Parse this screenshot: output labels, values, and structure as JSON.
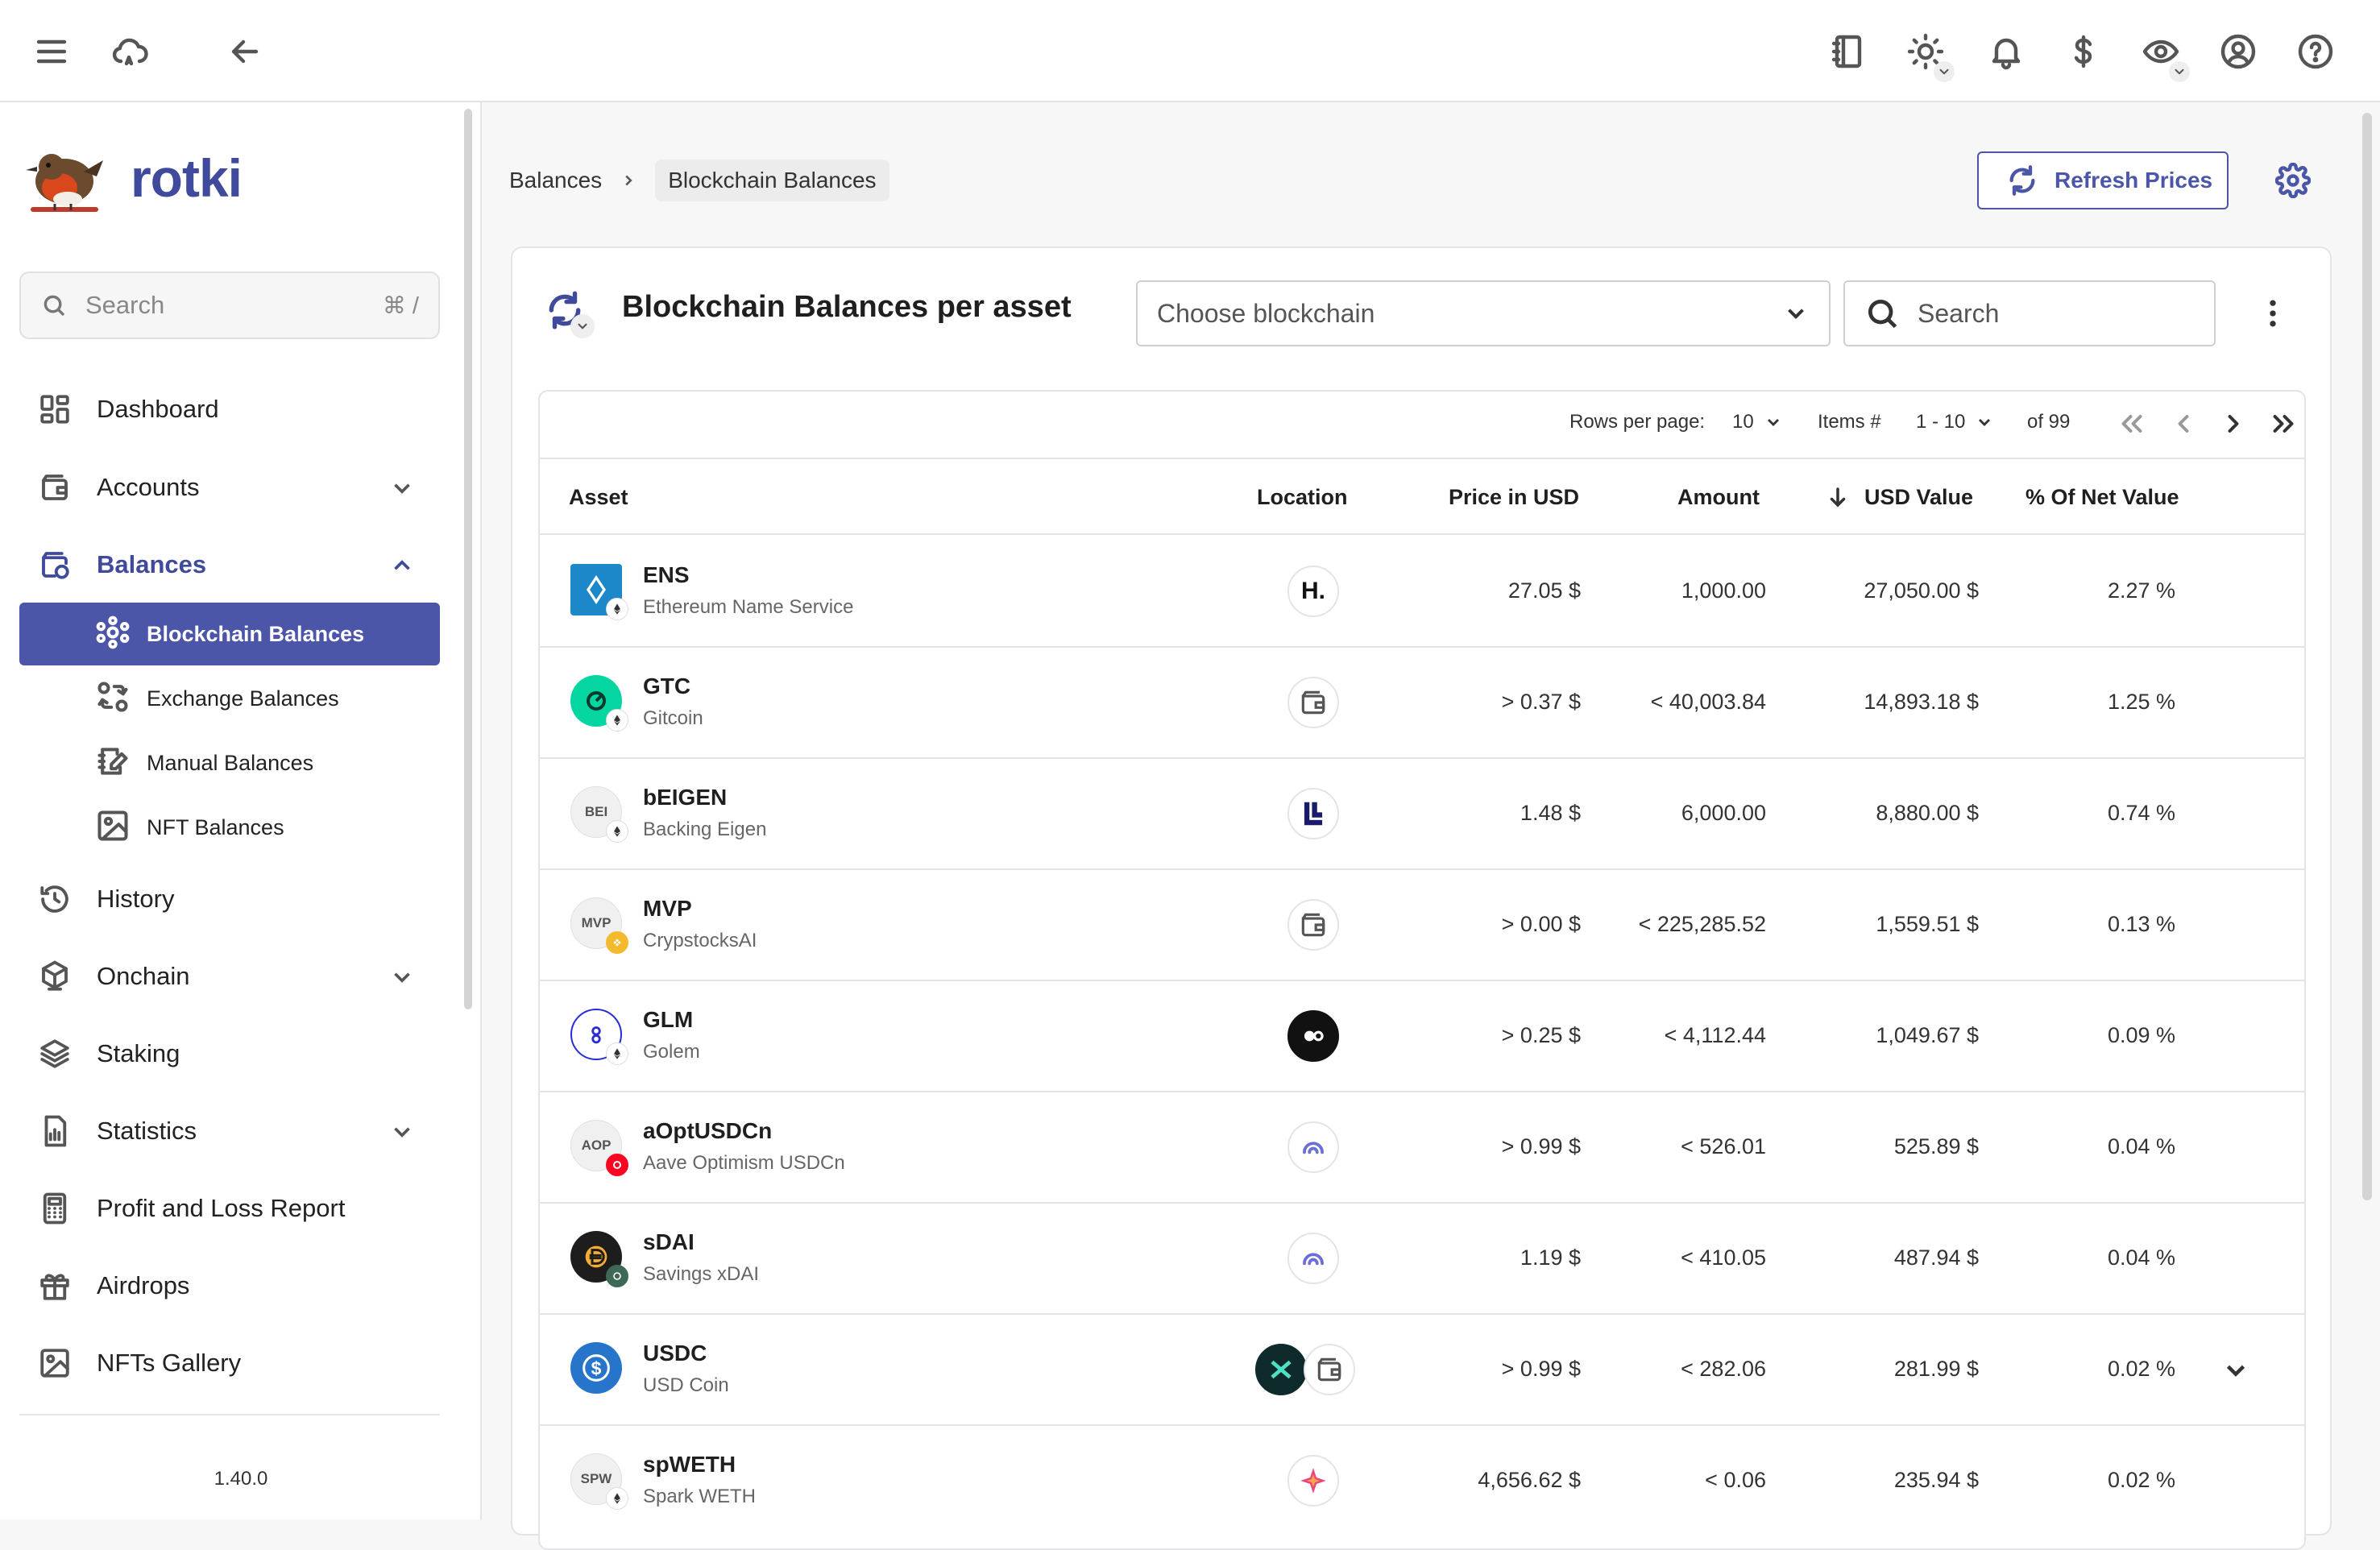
{
  "app": {
    "name": "rotki",
    "version": "1.40.0"
  },
  "sidebar": {
    "search_placeholder": "Search",
    "search_shortcut": "⌘ /",
    "items": [
      {
        "label": "Dashboard"
      },
      {
        "label": "Accounts"
      },
      {
        "label": "Balances"
      },
      {
        "label": "History"
      },
      {
        "label": "Onchain"
      },
      {
        "label": "Staking"
      },
      {
        "label": "Statistics"
      },
      {
        "label": "Profit and Loss Report"
      },
      {
        "label": "Airdrops"
      },
      {
        "label": "NFTs Gallery"
      }
    ],
    "balances_sub": [
      {
        "label": "Blockchain Balances"
      },
      {
        "label": "Exchange Balances"
      },
      {
        "label": "Manual Balances"
      },
      {
        "label": "NFT Balances"
      }
    ]
  },
  "breadcrumb": {
    "parent": "Balances",
    "current": "Blockchain Balances"
  },
  "header": {
    "refresh_label": "Refresh Prices"
  },
  "card": {
    "title": "Blockchain Balances per asset",
    "chain_placeholder": "Choose blockchain",
    "search_placeholder": "Search"
  },
  "pager": {
    "rows_label": "Rows per page:",
    "rows_value": "10",
    "items_label": "Items #",
    "items_value": "1 - 10",
    "of_total": "of 99"
  },
  "columns": {
    "asset": "Asset",
    "location": "Location",
    "price": "Price in USD",
    "amount": "Amount",
    "usd_value": "USD Value",
    "pct": "% Of Net Value"
  },
  "rows": [
    {
      "symbol": "ENS",
      "name": "Ethereum Name Service",
      "price": "27.05 $",
      "amount": "1,000.00",
      "usd": "27,050.00 $",
      "pct": "2.27 %",
      "avatar": "ens-logo",
      "location": "hyperliquid-icon"
    },
    {
      "symbol": "GTC",
      "name": "Gitcoin",
      "price": "> 0.37 $",
      "amount": "< 40,003.84",
      "usd": "14,893.18 $",
      "pct": "1.25 %",
      "avatar": "gitcoin-logo",
      "location": "wallet-icon"
    },
    {
      "symbol": "bEIGEN",
      "name": "Backing Eigen",
      "avatar_text": "BEI",
      "price": "1.48 $",
      "amount": "6,000.00",
      "usd": "8,880.00 $",
      "pct": "0.74 %",
      "location": "eigenlayer-icon"
    },
    {
      "symbol": "MVP",
      "name": "CrypstocksAI",
      "avatar_text": "MVP",
      "price": "> 0.00 $",
      "amount": "< 225,285.52",
      "usd": "1,559.51 $",
      "pct": "0.13 %",
      "location": "wallet-icon"
    },
    {
      "symbol": "GLM",
      "name": "Golem",
      "price": "> 0.25 $",
      "amount": "< 4,112.44",
      "usd": "1,049.67 $",
      "pct": "0.09 %",
      "avatar": "golem-logo",
      "location": "protocol-icon"
    },
    {
      "symbol": "aOptUSDCn",
      "name": "Aave Optimism USDCn",
      "avatar_text": "AOP",
      "price": "> 0.99 $",
      "amount": "< 526.01",
      "usd": "525.89 $",
      "pct": "0.04 %",
      "location": "gauge-icon"
    },
    {
      "symbol": "sDAI",
      "name": "Savings xDAI",
      "price": "1.19 $",
      "amount": "< 410.05",
      "usd": "487.94 $",
      "pct": "0.04 %",
      "avatar": "sdai-logo",
      "location": "gauge-icon"
    },
    {
      "symbol": "USDC",
      "name": "USD Coin",
      "price": "> 0.99 $",
      "amount": "< 282.06",
      "usd": "281.99 $",
      "pct": "0.02 %",
      "avatar": "usdc-logo",
      "location": "multiple-locations-icon",
      "expandable": true
    },
    {
      "symbol": "spWETH",
      "name": "Spark WETH",
      "avatar_text": "SPW",
      "price": "4,656.62 $",
      "amount": "< 0.06",
      "usd": "235.94 $",
      "pct": "0.02 %",
      "location": "spark-icon"
    }
  ],
  "colors": {
    "accent": "#4c56a8",
    "accent_dark": "#3f4a9c"
  }
}
